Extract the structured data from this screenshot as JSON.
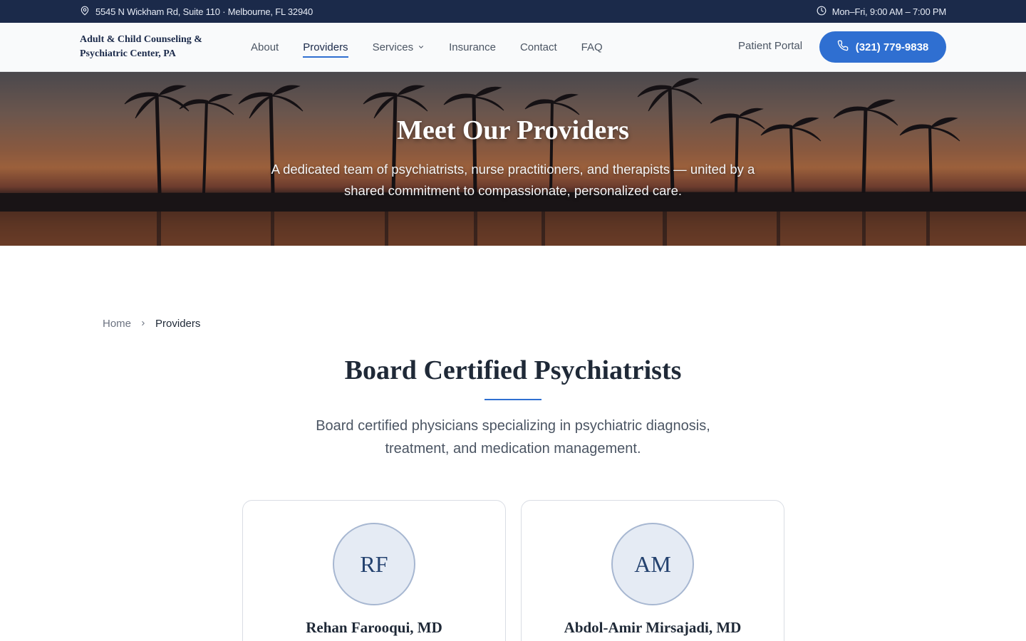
{
  "topbar": {
    "address": "5545 N Wickham Rd, Suite 110 · Melbourne, FL 32940",
    "hours": "Mon–Fri, 9:00 AM – 7:00 PM"
  },
  "header": {
    "brand": "Adult & Child Counseling & Psychiatric Center, PA",
    "nav": [
      {
        "label": "About"
      },
      {
        "label": "Providers",
        "active": true
      },
      {
        "label": "Services",
        "dropdown": true
      },
      {
        "label": "Insurance"
      },
      {
        "label": "Contact"
      },
      {
        "label": "FAQ"
      }
    ],
    "portal_label": "Patient Portal",
    "phone_label": "(321) 779-9838"
  },
  "hero": {
    "title": "Meet Our Providers",
    "subtitle": "A dedicated team of psychiatrists, nurse practitioners, and therapists — united by a shared commitment to compassionate, personalized care."
  },
  "breadcrumb": {
    "home": "Home",
    "current": "Providers"
  },
  "section": {
    "title": "Board Certified Psychiatrists",
    "subtitle": "Board certified physicians specializing in psychiatric diagnosis, treatment, and medication management."
  },
  "providers": [
    {
      "initials": "RF",
      "name": "Rehan Farooqui, MD"
    },
    {
      "initials": "AM",
      "name": "Abdol-Amir Mirsajadi, MD"
    }
  ],
  "colors": {
    "topbar": "#1b2a4a",
    "accent": "#2f6fd1",
    "avatar_bg": "#e5ebf4"
  },
  "icons": {
    "address": "map-pin-icon",
    "hours": "clock-icon",
    "phone": "phone-icon",
    "dropdown": "chevron-down-icon",
    "breadcrumb_sep": "chevron-right-icon"
  }
}
